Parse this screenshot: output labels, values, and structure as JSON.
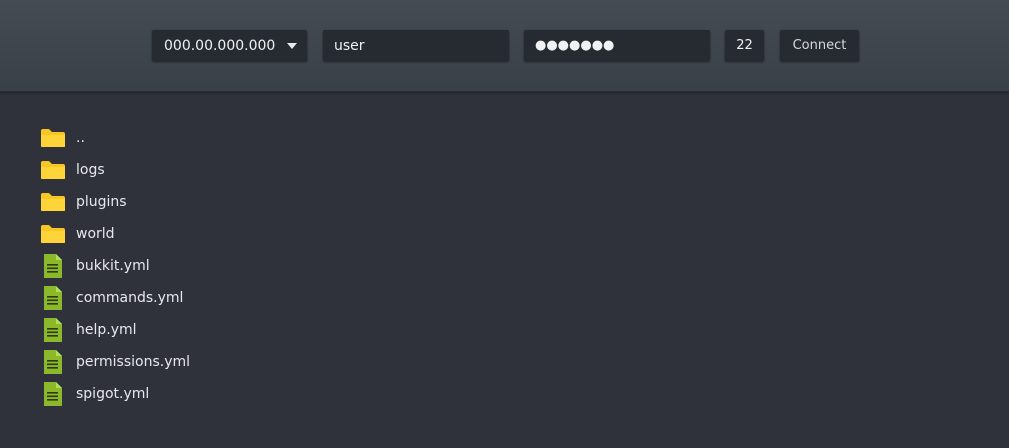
{
  "connection": {
    "host": "000.00.000.000",
    "username": "user",
    "password_masked": "●●●●●●●",
    "port": "22",
    "connect_label": "Connect"
  },
  "files": [
    {
      "name": "..",
      "type": "folder",
      "icon": "folder-icon"
    },
    {
      "name": "logs",
      "type": "folder",
      "icon": "folder-icon"
    },
    {
      "name": "plugins",
      "type": "folder",
      "icon": "folder-icon"
    },
    {
      "name": "world",
      "type": "folder",
      "icon": "folder-icon"
    },
    {
      "name": "bukkit.yml",
      "type": "file",
      "icon": "file-icon"
    },
    {
      "name": "commands.yml",
      "type": "file",
      "icon": "file-icon"
    },
    {
      "name": "help.yml",
      "type": "file",
      "icon": "file-icon"
    },
    {
      "name": "permissions.yml",
      "type": "file",
      "icon": "file-icon"
    },
    {
      "name": "spigot.yml",
      "type": "file",
      "icon": "file-icon"
    }
  ],
  "colors": {
    "folder": "#f9c623",
    "file": "#8cb82b",
    "background": "#2f323b",
    "toolbar": "#3e454d"
  }
}
